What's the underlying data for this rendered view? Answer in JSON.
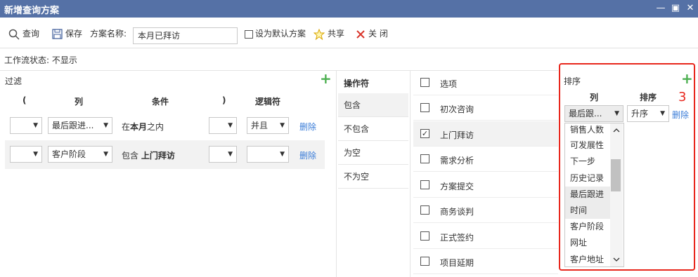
{
  "window": {
    "title": "新增查询方案",
    "minimize": "—",
    "maximize": "▣",
    "close": "✕"
  },
  "toolbar": {
    "query": "查询",
    "save": "保存",
    "scheme_name_label": "方案名称:",
    "scheme_name_value": "本月已拜访",
    "default_label": "设为默认方案",
    "share": "共享",
    "close": "关 闭"
  },
  "workflow": {
    "text": "工作流状态: 不显示"
  },
  "filter": {
    "title": "过滤",
    "headers": {
      "lparen": "(",
      "column": "列",
      "condition": "条件",
      "rparen": ")",
      "logic": "逻辑符"
    },
    "rows": [
      {
        "column": "最后跟进...",
        "condition_prefix": "在",
        "condition_bold": "本月",
        "condition_suffix": "之内",
        "logic": "并且",
        "delete": "删除"
      },
      {
        "column": "客户阶段",
        "condition_prefix": "包含 ",
        "condition_bold": "上门拜访",
        "condition_suffix": "",
        "logic": "",
        "delete": "删除"
      }
    ]
  },
  "operators": {
    "title": "操作符",
    "items": [
      "包含",
      "不包含",
      "为空",
      "不为空"
    ],
    "selected": "包含"
  },
  "options": {
    "header": "选项",
    "items": [
      {
        "label": "初次咨询",
        "checked": false
      },
      {
        "label": "上门拜访",
        "checked": true
      },
      {
        "label": "需求分析",
        "checked": false
      },
      {
        "label": "方案提交",
        "checked": false
      },
      {
        "label": "商务谈判",
        "checked": false
      },
      {
        "label": "正式签约",
        "checked": false
      },
      {
        "label": "项目延期",
        "checked": false
      }
    ]
  },
  "sort": {
    "title": "排序",
    "col_header": "列",
    "order_header": "排序",
    "annotation": "3",
    "column_value": "最后跟...",
    "order_value": "升序",
    "delete": "删除",
    "dropdown": [
      "销售人数",
      "可发展性",
      "下一步",
      "历史记录",
      "最后跟进",
      "时间",
      "客户阶段",
      "网址",
      "客户地址"
    ]
  },
  "colors": {
    "titlebar": "#5571a6",
    "accent_link": "#3b7dd8",
    "plus_green": "#4caf50",
    "annotation_red": "#e8261c"
  }
}
